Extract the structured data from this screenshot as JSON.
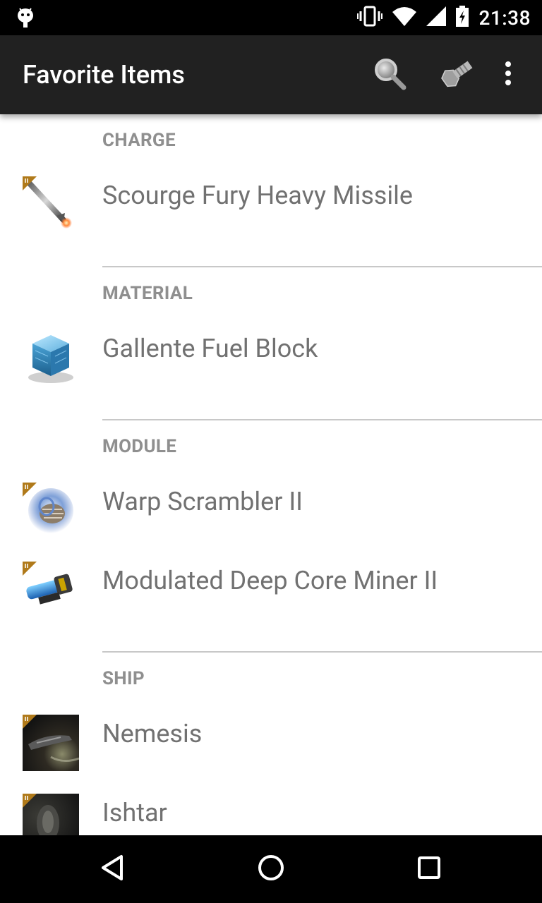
{
  "status_bar": {
    "time": "21:38",
    "icons": [
      "android-debug-icon",
      "vibrate-icon",
      "wifi-icon",
      "signal-icon",
      "battery-charging-icon"
    ]
  },
  "app_bar": {
    "title": "Favorite Items",
    "actions": [
      "search-icon",
      "fitting-icon",
      "overflow-menu-icon"
    ]
  },
  "sections": [
    {
      "header": "CHARGE",
      "items": [
        {
          "label": "Scourge Fury Heavy Missile",
          "icon": "missile-icon",
          "meta_tag": "II"
        }
      ]
    },
    {
      "header": "MATERIAL",
      "items": [
        {
          "label": "Gallente Fuel Block",
          "icon": "fuel-block-icon"
        }
      ]
    },
    {
      "header": "MODULE",
      "items": [
        {
          "label": "Warp Scrambler II",
          "icon": "warp-scrambler-icon",
          "meta_tag": "II"
        },
        {
          "label": "Modulated Deep Core Miner II",
          "icon": "deep-core-miner-icon",
          "meta_tag": "II"
        }
      ]
    },
    {
      "header": "SHIP",
      "items": [
        {
          "label": "Nemesis",
          "icon": "ship-nemesis-icon",
          "meta_tag": "II"
        },
        {
          "label": "Ishtar",
          "icon": "ship-ishtar-icon",
          "meta_tag": "II"
        }
      ]
    }
  ],
  "nav_bar": {
    "buttons": [
      "back-icon",
      "home-icon",
      "recents-icon"
    ]
  },
  "colors": {
    "app_bar": "#212121",
    "status_bar": "#000000",
    "header_text": "#8f8f8f",
    "item_text": "#717171",
    "divider": "#c8c8c8",
    "meta_tag": "#b07a1a"
  }
}
